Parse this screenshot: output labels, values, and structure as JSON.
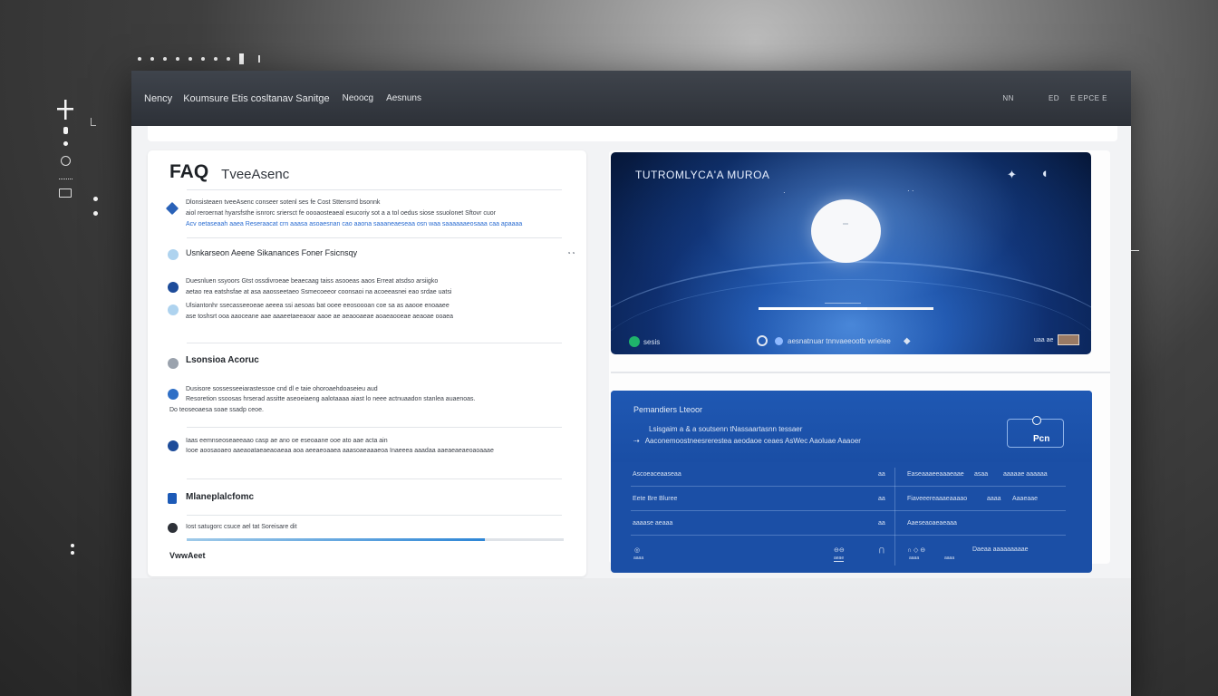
{
  "left_rail": {
    "plus_icon": "plus-icon",
    "icons": [
      "plus-icon",
      "pin-icon",
      "dot-icon",
      "globe-icon",
      "window-icon",
      "more-vertical-icon"
    ]
  },
  "titlebar": {
    "menus": [
      "Nency",
      "Koumsure Etis cosltanav Sanitge",
      "Neoocg",
      "Aesnuns"
    ],
    "right_items": [
      "NN",
      "ED",
      "E EPCE E"
    ]
  },
  "faq": {
    "title": "FAQ",
    "subtitle": "TveeAsenc",
    "item1": {
      "line1": "Dlonsisteaen tveeAsenc conseer sotenl ses fe Cost Sttensrrd bsonnk",
      "line2": "aiol reroernat hyarsfsthe isnrorc sriersct fe oooaosteaeal esucoriy sot a a tol oedus siose ssuolonet Sftovr cuor",
      "line3": "Acv oetaseaah aaea Reseraacat crn aaasa asoaesnan cao aaona saaaneaeseaa osn waa saaaaaaeosaaa caa apaaaa"
    },
    "item2": {
      "title": "Usnkarseon Aeene Sikanances Foner Fsicnsqy",
      "icon": "chat-icon",
      "lineA1": "Duesnluen ssyoors Gtst ossdivroeae beaecaag taiss  asooeas aaos Erreat atsdso arsiigko",
      "lineA2": "aetao rea eatshsfae at asa aaosseetaeo Ssmecoeeor coonsaoi na acoeeasnei eao srdae uatsi",
      "lineB1": "Ulsiantonhr ssecasseeoeae aeeea ssi aesoas bat ooee eeosoooan coe sa as aaooe enoaaee",
      "lineB2": "ase toshsrt ooa aaoceane aae aaaeetaeeaoar aaoe ae aeaooaeae aoaeaooeae aeaoae ooaea"
    },
    "item3": {
      "title": "Lsonsioa Acoruc",
      "lineA1": "Dusisore sossesseeiarastessoe cnd dl e taie  ohoroaehdoaseieu aud",
      "lineA2": "Resoretion ssoosas hrserad assitte aseoeiaeng aalotaaaa aiast lo neee actnuaadon stanlea auaenoas.",
      "lineA3": "Do teoseoaesa soae ssadp ceoe.",
      "lineB1": "Iaas eemnseoseaeeaao casp ae ano oe eseoaane ooe ato aae acta ain",
      "lineB2": "Iooe aoosaoaeo aaeaoataeaeaoaeaa aoa aeeaeoaaea aaasoaeaaaeoa Inaeeea aaadaa aaeaeaeaeoaoaaae"
    },
    "item4": {
      "title": "Mlaneplalcfomc",
      "line1": "Iost satugorc csuce ael tat  Soreisare dit"
    },
    "progress": 0.79,
    "footer": "VwwAeet"
  },
  "video": {
    "title": "TUTROMLYCA'A MUROA",
    "icons": [
      "share-icon",
      "fullscreen-icon",
      "play-icon",
      "green-dot-icon",
      "cc-icon",
      "settings-icon"
    ],
    "left_label": "sesis",
    "mid_label": "aesnatnuar tnnvaeeootb wrieiee",
    "right_label": "uaa ae",
    "progress": 0.62
  },
  "panel": {
    "title": "Pemandiers Lteoor",
    "line1": "Lsisgaim a & a soutsenn tNassaartasnn tessaer",
    "line2": "Aaconemoostneesrerestea aeodaoe ceaes AsWec Aaoluae Aaaoer",
    "button_label": "Pcn",
    "rows": [
      {
        "c1": "Ascoeaceaaseaa",
        "c2": "aa",
        "c3": "Easeaaaeeaaaeaae",
        "c4": "asaa",
        "c5": "aaaaae aaaaaa"
      },
      {
        "c1": "Eete Bre Bluree",
        "c2": "aa",
        "c3": "Fiaveeereaaaeaaaao",
        "c4": "aaaa",
        "c5": "Aaaeaae"
      },
      {
        "c1": "aaaase aeaaa",
        "c2": "aa",
        "c3": "Aaeseaoaeaeaaa",
        "c4": "",
        "c5": ""
      }
    ],
    "footer": {
      "f1": "aaaa",
      "f2": "aeae",
      "f3": "aaaa",
      "f4": "aaaa",
      "f5": "Daeaa aaaaaaaaae"
    }
  },
  "colors": {
    "titlebar": "#2d3138",
    "accent_blue": "#1b4fa6",
    "link_blue": "#2a6cd1",
    "bullet_dark": "#1d4c9a",
    "bullet_light": "#aed3ef"
  }
}
